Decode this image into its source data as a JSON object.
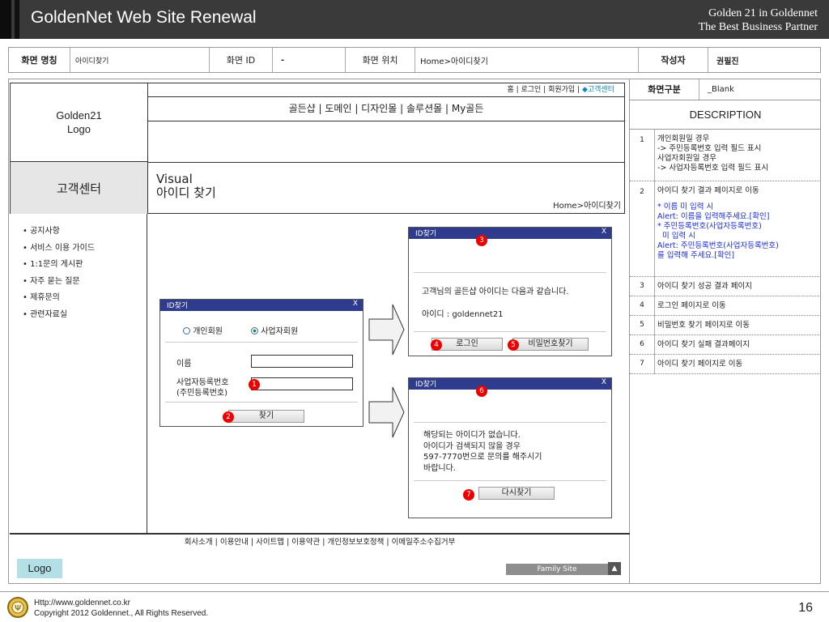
{
  "title": "GoldenNet Web Site Renewal",
  "title_right": [
    "Golden 21 in Goldennet",
    "The Best Business Partner"
  ],
  "header": {
    "screen_name_label": "화면 명칭",
    "screen_name": "아이디찾기",
    "screen_id_label": "화면 ID",
    "screen_id": "-",
    "screen_pos_label": "화면 위치",
    "screen_pos": "Home>아이디찾기",
    "author_label": "작성자",
    "author": "권필진"
  },
  "site": {
    "logo": [
      "Golden21",
      "Logo"
    ],
    "top_links": "홈 | 로그인 | 회원가입 | ",
    "top_links_active": "◆고객센터",
    "gnb": "골든샵 | 도메인 | 디자인몰 | 솔루션몰 | My골든",
    "section_title": "고객센터",
    "visual_line1": "Visual",
    "visual_line2": "아이디 찾기",
    "breadcrumb": "Home>아이디찾기",
    "lnb": [
      "• 공지사항",
      "• 서비스 이용 가이드",
      "• 1:1문의 게시판",
      "• 자주 묻는 질문",
      "• 제휴문의",
      "• 관련자료실"
    ],
    "footer_links": "회사소개 | 이용안내 | 사이트맵 | 이용약관 | 개인정보보호정책 | 이메일주소수집거부",
    "footer_logo": "Logo",
    "family_site": "Family Site",
    "family_arrow": "▲"
  },
  "form_popup": {
    "title": "ID찾기",
    "close": "X",
    "radio_personal": "개인회원",
    "radio_business": "사업자회원",
    "name_label": "이름",
    "bizno_label1": "사업자등록번호",
    "bizno_label2": "(주민등록번호)",
    "find_button": "찾기"
  },
  "success_popup": {
    "title": "ID찾기",
    "close": "X",
    "message": "고객님의 골든샵 아이디는 다음과 같습니다.",
    "id_line": "아이디 : goldennet21",
    "login_button": "로그인",
    "pw_button": "비밀번호찾기"
  },
  "fail_popup": {
    "title": "ID찾기",
    "close": "X",
    "msg1": "해당되는 아이디가 없습니다.",
    "msg2": "아이디가 검색되지 않을 경우",
    "msg3": "597-7770번으로 문의를 해주시기",
    "msg4": "바랍니다.",
    "retry_button": "다시찾기"
  },
  "badges": [
    "1",
    "2",
    "3",
    "4",
    "5",
    "6",
    "7"
  ],
  "desc": {
    "type_label": "화면구분",
    "type_value": "_Blank",
    "heading": "DESCRIPTION",
    "rows": [
      {
        "num": "1",
        "lines": [
          "개인회원일 경우",
          "-> 주민등록번호 입력 필드 표시",
          "사업자회원일 경우",
          "-> 사업자등록번호 입력 필드 표시"
        ]
      },
      {
        "num": "2",
        "lines": [
          "아이디 찾기 결과 페이지로 이동"
        ],
        "blue": [
          "* 이름 미 입력 시",
          "Alert: 이름을 입력해주세요.[확인]",
          "* 주민등록번호(사업자등록번호)",
          "  미 입력 시",
          "Alert: 주민등록번호(사업자등록번호)",
          "를 입력해 주세요.[확인]"
        ]
      },
      {
        "num": "3",
        "lines": [
          "아이디 찾기 성공 결과 페이지"
        ]
      },
      {
        "num": "4",
        "lines": [
          "로그인 페이지로 이동"
        ]
      },
      {
        "num": "5",
        "lines": [
          "비밀번호 찾기 페이지로 이동"
        ]
      },
      {
        "num": "6",
        "lines": [
          "아이디 찾기 실패 결과페이지"
        ]
      },
      {
        "num": "7",
        "lines": [
          "아이디 찾기 페이지로 이동"
        ]
      }
    ]
  },
  "footer": {
    "url": "Http://www.goldennet.co.kr",
    "copyright": "Copyright 2012 Goldennet., All Rights Reserved.",
    "page": "16"
  }
}
